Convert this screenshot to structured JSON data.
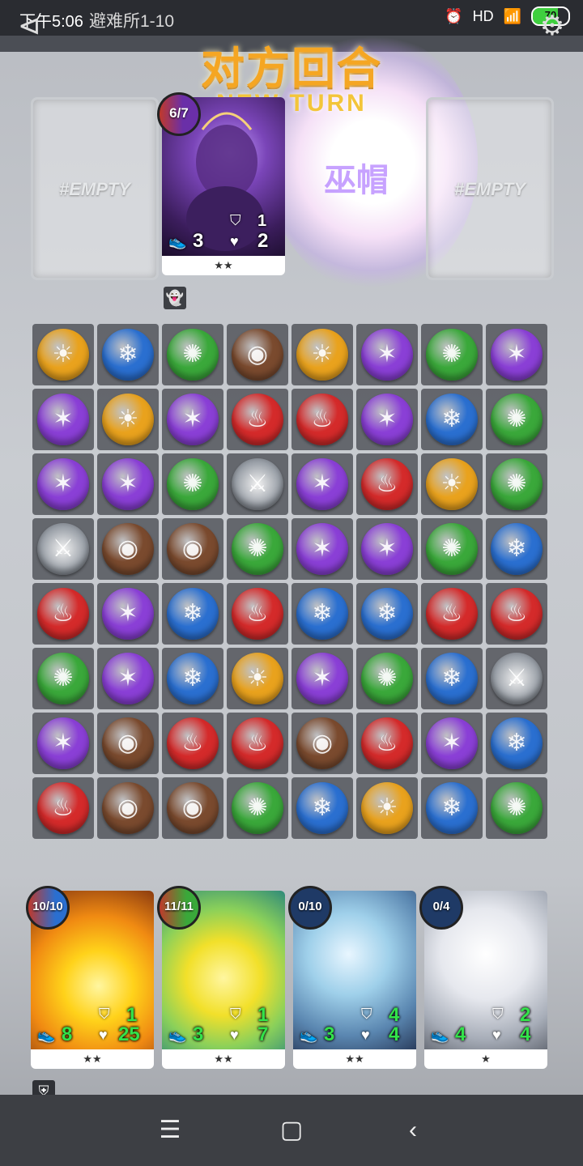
{
  "status": {
    "time": "下午5:06",
    "signal": "HD",
    "battery": "70"
  },
  "level_title": "避难所1-10",
  "banner": {
    "title": "对方回合",
    "subtitle": "NEW  TURN"
  },
  "icons": {
    "back": "back-arrow-icon",
    "settings": "gear-icon",
    "ghost": "ghost-icon",
    "shield": "shield-icon"
  },
  "enemy_row": [
    {
      "type": "empty",
      "label": "#EMPTY"
    },
    {
      "type": "card",
      "cost": "6/7",
      "speed": "3",
      "armor": "1",
      "hp": "2",
      "stars": "★★",
      "art": "demon"
    },
    {
      "type": "summoning",
      "label": "巫帽"
    },
    {
      "type": "empty",
      "label": "#EMPTY"
    }
  ],
  "gem_colors": {
    "Y": "#e9a21d",
    "B": "#2a6fd0",
    "G": "#3aa83a",
    "N": "#7a4a2e",
    "P": "#8a3fd6",
    "R": "#d42a2a",
    "S": "#9aa0a8"
  },
  "gem_glyphs": {
    "Y": "☀",
    "B": "❄",
    "G": "✺",
    "N": "◉",
    "P": "✶",
    "R": "♨",
    "S": "⚔"
  },
  "board": [
    [
      "Y",
      "B",
      "G",
      "N",
      "Y",
      "P",
      "G",
      "P"
    ],
    [
      "P",
      "Y",
      "P",
      "R",
      "R",
      "P",
      "B",
      "G"
    ],
    [
      "P",
      "P",
      "G",
      "S",
      "P",
      "R",
      "Y",
      "G"
    ],
    [
      "S",
      "N",
      "N",
      "G",
      "P",
      "P",
      "G",
      "B"
    ],
    [
      "R",
      "P",
      "B",
      "R",
      "B",
      "B",
      "R",
      "R"
    ],
    [
      "G",
      "P",
      "B",
      "Y",
      "P",
      "G",
      "B",
      "S"
    ],
    [
      "P",
      "N",
      "R",
      "R",
      "N",
      "R",
      "P",
      "B"
    ],
    [
      "R",
      "N",
      "N",
      "G",
      "B",
      "Y",
      "B",
      "G"
    ]
  ],
  "hand": [
    {
      "cost": "10/10",
      "speed": "8",
      "armor": "1",
      "hp": "25",
      "stars": "★★",
      "art": "fire"
    },
    {
      "cost": "11/11",
      "speed": "3",
      "armor": "1",
      "hp": "7",
      "stars": "★★",
      "art": "light"
    },
    {
      "cost": "0/10",
      "speed": "3",
      "armor": "4",
      "hp": "4",
      "stars": "★★",
      "art": "ice"
    },
    {
      "cost": "0/4",
      "speed": "4",
      "armor": "2",
      "hp": "4",
      "stars": "★",
      "art": "maiden"
    }
  ],
  "nav": {
    "menu": "☰",
    "home": "▢",
    "back": "‹"
  }
}
